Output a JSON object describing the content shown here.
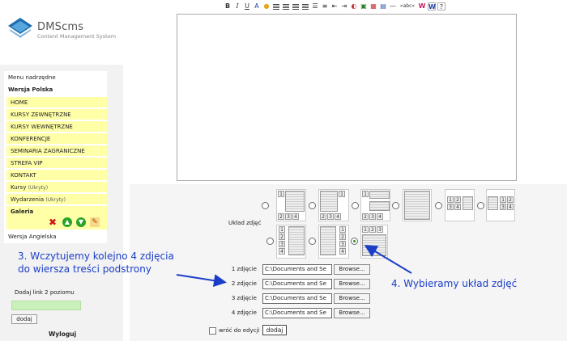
{
  "logo": {
    "title": "DMScms",
    "subtitle": "Content Management System"
  },
  "sidebar": {
    "parent_menu": "Menu nadrzędne",
    "version_pl": "Wersja Polska",
    "items": [
      {
        "label": "HOME"
      },
      {
        "label": "KURSY ZEWNĘTRZNE"
      },
      {
        "label": "KURSY WEWNĘTRZNE"
      },
      {
        "label": "KONFERENCJE"
      },
      {
        "label": "SEMINARIA ZAGRANICZNE"
      },
      {
        "label": "STREFA VIP"
      },
      {
        "label": "KONTAKT"
      },
      {
        "label": "Kursy",
        "hint": "(Ukryty)"
      },
      {
        "label": "Wydarzenia",
        "hint": "(Ukryty)"
      },
      {
        "label": "Galeria"
      }
    ],
    "version_en": "Wersja Angielska",
    "add_sublink_label": "Dodaj link 2 poziomu",
    "add_sublink_value": "",
    "add_button": "dodaj",
    "logout": "Wyloguj",
    "icons": [
      "delete-icon",
      "move-up-icon",
      "move-down-icon",
      "edit-icon"
    ]
  },
  "toolbar": {
    "buttons": [
      "B",
      "I",
      "U",
      "A"
    ],
    "icons": [
      "bold-icon",
      "italic-icon",
      "underline-icon",
      "font-color-icon",
      "paint-icon",
      "align-left-icon",
      "align-center-icon",
      "align-right-icon",
      "justify-icon",
      "bullet-list-icon",
      "numbered-list-icon",
      "outdent-icon",
      "indent-icon",
      "color-picker-icon",
      "image-icon",
      "table-icon",
      "grid-icon",
      "horizontal-rule-icon",
      "strikethrough-icon",
      "word-icon",
      "word-paste-icon",
      "help-icon"
    ],
    "strike_label": "»abc«",
    "help_label": "?"
  },
  "editor": {
    "content": ""
  },
  "layout": {
    "label": "Układ zdjęć",
    "selected_index": 8,
    "cell_numbers": [
      "1",
      "2",
      "3",
      "4"
    ]
  },
  "photos": [
    {
      "label": "1 zdjęcie",
      "value": "C:\\Documents and Se",
      "browse": "Browse..."
    },
    {
      "label": "2 zdjęcie",
      "value": "C:\\Documents and Se",
      "browse": "Browse..."
    },
    {
      "label": "3 zdjęcie",
      "value": "C:\\Documents and Se",
      "browse": "Browse..."
    },
    {
      "label": "4 zdjęcie",
      "value": "C:\\Documents and Se",
      "browse": "Browse..."
    }
  ],
  "return_to_edit": {
    "label": "wróć do edycji",
    "checked": false,
    "button": "dodaj"
  },
  "annotations": {
    "left_line1": "3. Wczytujemy kolejno 4 zdjęcia",
    "left_line2": "do wiersza treści podstrony",
    "right": "4. Wybieramy układ zdjęć",
    "color": "#1a3ec8"
  }
}
